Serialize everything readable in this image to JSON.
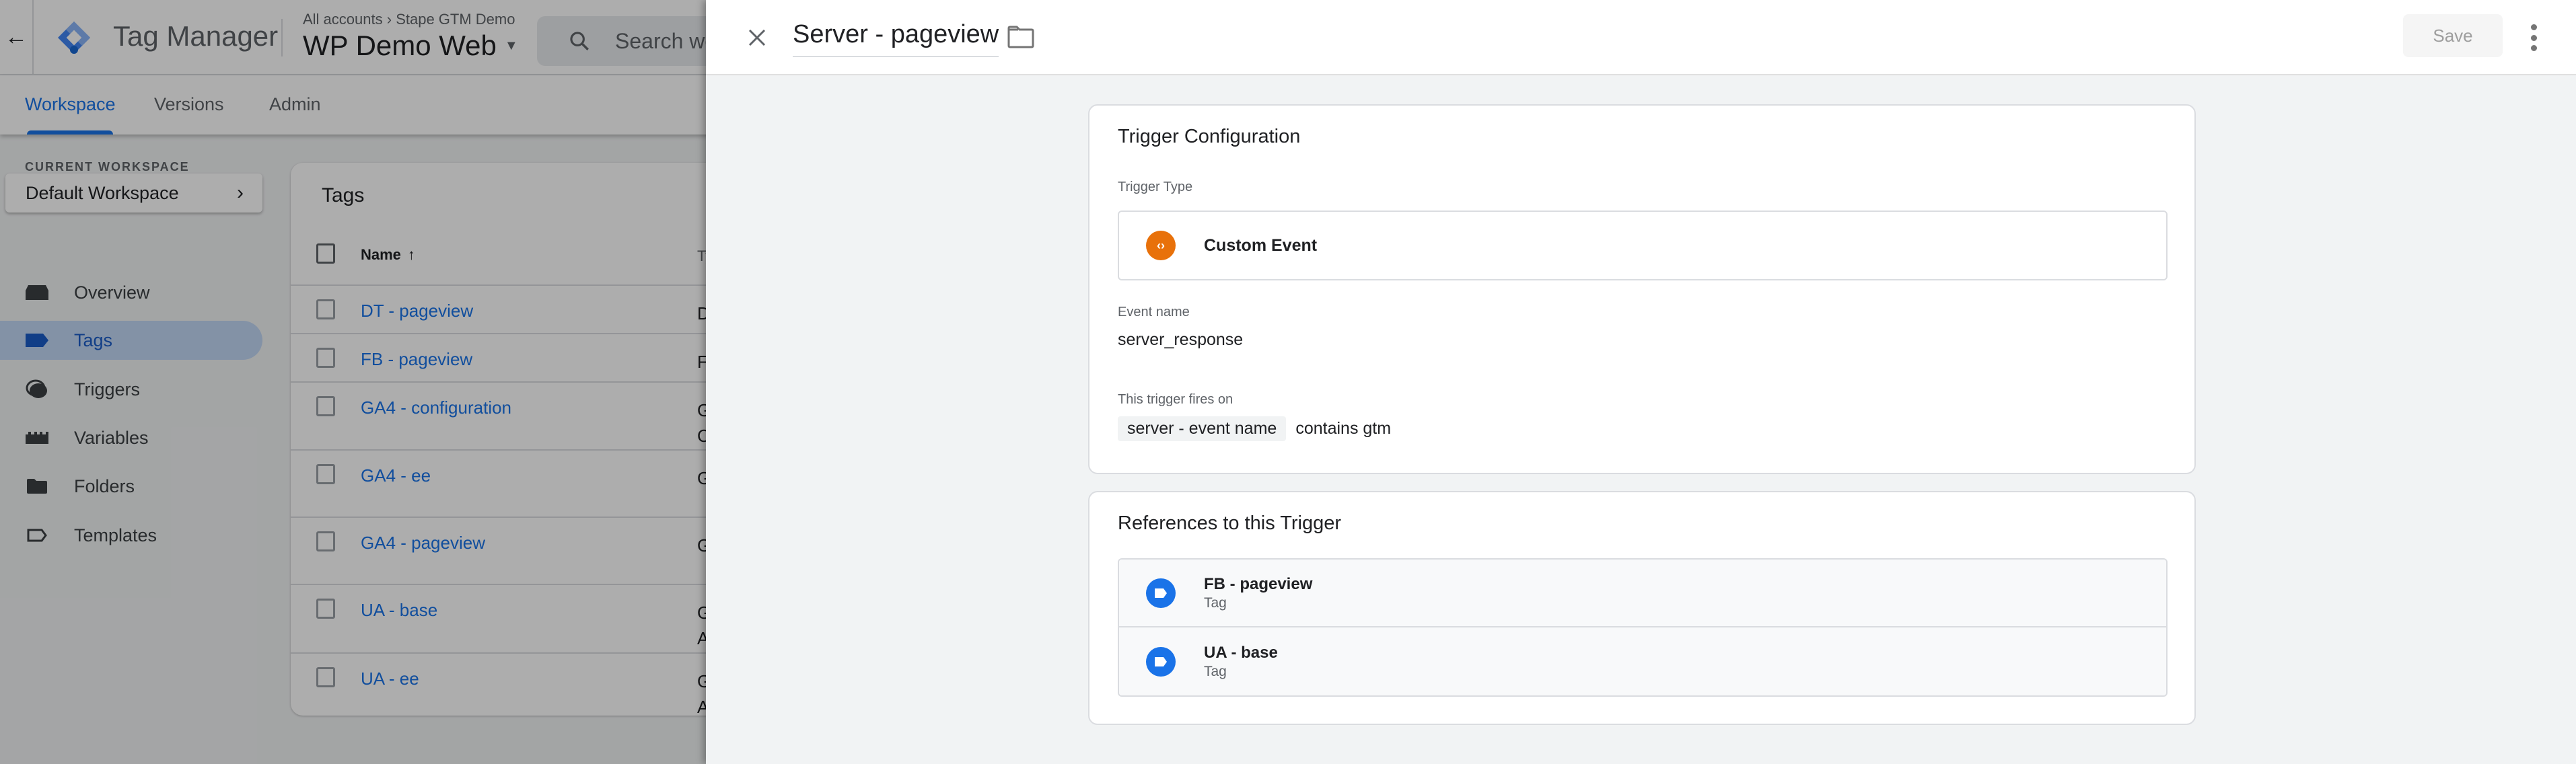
{
  "app": {
    "name": "Tag Manager",
    "breadcrumb": [
      "All accounts",
      "Stape GTM Demo"
    ],
    "container_name": "WP Demo Web",
    "search_placeholder": "Search workspace"
  },
  "tabs": [
    {
      "label": "Workspace",
      "active": true
    },
    {
      "label": "Versions",
      "active": false
    },
    {
      "label": "Admin",
      "active": false
    }
  ],
  "sidebar": {
    "current_workspace_label": "CURRENT WORKSPACE",
    "workspace_name": "Default Workspace",
    "items": [
      {
        "label": "Overview",
        "icon": "overview-icon",
        "active": false
      },
      {
        "label": "Tags",
        "icon": "tag-icon",
        "active": true
      },
      {
        "label": "Triggers",
        "icon": "trigger-icon",
        "active": false
      },
      {
        "label": "Variables",
        "icon": "variables-icon",
        "active": false
      },
      {
        "label": "Folders",
        "icon": "folder-icon",
        "active": false
      },
      {
        "label": "Templates",
        "icon": "template-icon",
        "active": false
      }
    ]
  },
  "tags_table": {
    "title": "Tags",
    "columns": {
      "name": "Name",
      "type": "Ty"
    },
    "rows": [
      {
        "name": "DT - pageview",
        "type": [
          "D"
        ]
      },
      {
        "name": "FB - pageview",
        "type": [
          "F"
        ]
      },
      {
        "name": "GA4 - configuration",
        "type": [
          "G",
          "C"
        ]
      },
      {
        "name": "GA4 - ee",
        "type": [
          "G"
        ]
      },
      {
        "name": "GA4 - pageview",
        "type": [
          "G"
        ]
      },
      {
        "name": "UA - base",
        "type": [
          "G",
          "A"
        ]
      },
      {
        "name": "UA - ee",
        "type": [
          "G",
          "A"
        ]
      }
    ]
  },
  "drawer": {
    "title": "Server - pageview",
    "save_label": "Save",
    "trigger_config": {
      "title": "Trigger Configuration",
      "type_label": "Trigger Type",
      "type_name": "Custom Event",
      "type_icon_glyph": "‹›",
      "type_icon_color": "#e8710a",
      "event_name_label": "Event name",
      "event_name": "server_response",
      "fires_on_label": "This trigger fires on",
      "condition": {
        "variable": "server - event name",
        "operator_value": "contains gtm"
      }
    },
    "references": {
      "title": "References to this Trigger",
      "icon_color": "#1a73e8",
      "items": [
        {
          "name": "FB - pageview",
          "kind": "Tag"
        },
        {
          "name": "UA - base",
          "kind": "Tag"
        }
      ]
    }
  }
}
